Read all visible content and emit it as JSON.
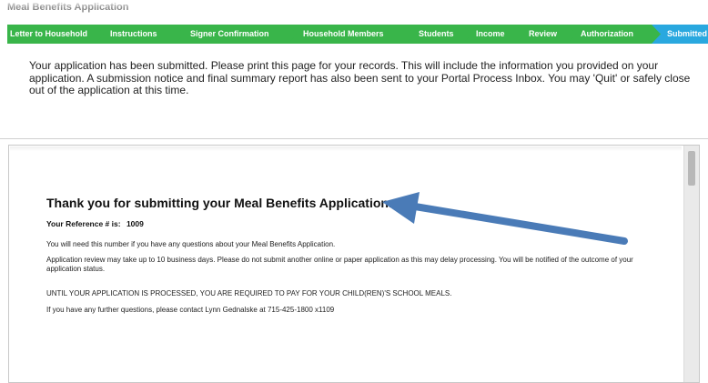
{
  "app": {
    "title": "Meal Benefits Application"
  },
  "steps": [
    {
      "label": "Letter to Household",
      "state": "done"
    },
    {
      "label": "Instructions",
      "state": "done"
    },
    {
      "label": "Signer Confirmation",
      "state": "done"
    },
    {
      "label": "Household Members",
      "state": "done"
    },
    {
      "label": "Students",
      "state": "done"
    },
    {
      "label": "Income",
      "state": "done"
    },
    {
      "label": "Review",
      "state": "done"
    },
    {
      "label": "Authorization",
      "state": "done"
    },
    {
      "label": "Submitted",
      "state": "current"
    }
  ],
  "colors": {
    "step_done": "#39b54a",
    "step_current": "#29a8df",
    "arrow": "#4a7bb7"
  },
  "intro": {
    "text": "Your application has been submitted. Please print this page for your records. This will include the information you provided on your application. A submission notice and final summary report has also been sent to your Portal Process Inbox. You may 'Quit' or safely close out of the application at this time."
  },
  "report": {
    "heading": "Thank you for submitting your Meal Benefits Application.",
    "reference_label": "Your Reference # is:",
    "reference_number": "1009",
    "line1": "You will need this number if you have any questions about your Meal Benefits Application.",
    "line2": "Application review may take up to 10 business days.  Please do not submit another online or paper application as this may delay processing.  You will be notified of the outcome of your application status.",
    "line3": "UNTIL YOUR APPLICATION IS PROCESSED, YOU ARE REQUIRED TO PAY FOR YOUR CHILD(REN)'S SCHOOL MEALS.",
    "line4": "If you have any further questions, please contact Lynn Gednalske at 715-425-1800 x1109"
  },
  "annotation": {
    "icon": "arrow-pointing-left-icon"
  }
}
